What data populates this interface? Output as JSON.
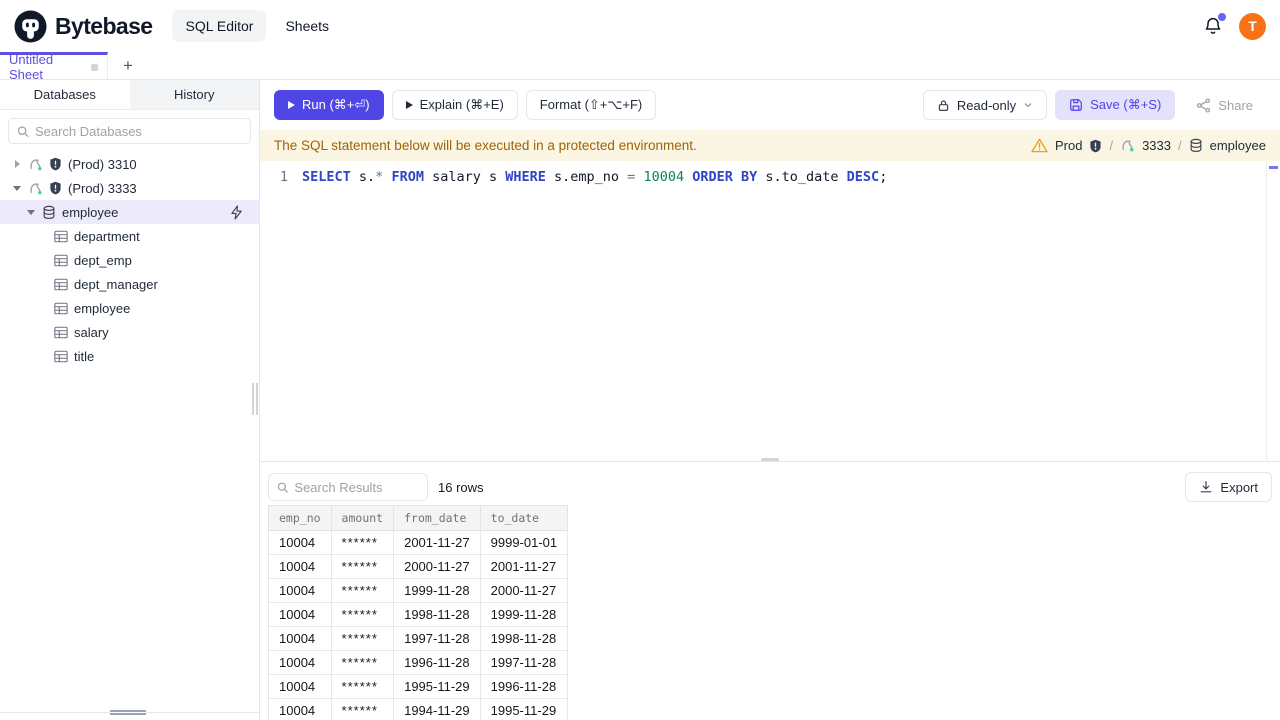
{
  "colors": {
    "accent": "#4f46e5",
    "accent_soft": "#e4e1fa",
    "selection_bg": "#eceafb",
    "tab_active": "#5b50e0",
    "banner_bg": "#faf6e3",
    "banner_text": "#a16207",
    "warning": "#f59e0b",
    "avatar_bg": "#f97316",
    "notification_dot": "#6366f1",
    "syntax_keyword": "#2f45c5",
    "syntax_number": "#098658",
    "syntax_operator": "#64748b"
  },
  "topbar": {
    "brand": "Bytebase",
    "nav": [
      {
        "label": "SQL Editor"
      },
      {
        "label": "Sheets"
      }
    ],
    "avatar_initial": "T"
  },
  "sheet_tabs": {
    "active_tab": "Untitled Sheet",
    "new_tab_label": "+"
  },
  "sidebar": {
    "tabs": [
      {
        "label": "Databases"
      },
      {
        "label": "History"
      }
    ],
    "search_placeholder": "Search Databases",
    "instances": [
      {
        "label": "(Prod) 3310"
      },
      {
        "label": "(Prod) 3333"
      }
    ],
    "database": {
      "label": "employee"
    },
    "tables": [
      {
        "label": "department"
      },
      {
        "label": "dept_emp"
      },
      {
        "label": "dept_manager"
      },
      {
        "label": "employee"
      },
      {
        "label": "salary"
      },
      {
        "label": "title"
      }
    ]
  },
  "toolbar": {
    "run_label": "Run (⌘+⏎)",
    "explain_label": "Explain (⌘+E)",
    "format_label": "Format (⇧+⌥+F)",
    "readonly_label": "Read-only",
    "save_label": "Save (⌘+S)",
    "share_label": "Share"
  },
  "banner": {
    "message": "The SQL statement below will be executed in a protected environment.",
    "environment": "Prod",
    "separator": "/",
    "instance": "3333",
    "database": "employee"
  },
  "editor": {
    "line_number": "1",
    "sql_text": "SELECT s.* FROM salary s WHERE s.emp_no = 10004 ORDER BY s.to_date DESC;",
    "tokens": [
      {
        "text": "SELECT",
        "type": "keyword"
      },
      {
        "text": " s.",
        "type": "ident"
      },
      {
        "text": "*",
        "type": "operator"
      },
      {
        "text": " ",
        "type": "ident"
      },
      {
        "text": "FROM",
        "type": "keyword"
      },
      {
        "text": " salary s ",
        "type": "ident"
      },
      {
        "text": "WHERE",
        "type": "keyword"
      },
      {
        "text": " s.emp_no ",
        "type": "ident"
      },
      {
        "text": "=",
        "type": "operator"
      },
      {
        "text": " ",
        "type": "ident"
      },
      {
        "text": "10004",
        "type": "number"
      },
      {
        "text": " ",
        "type": "ident"
      },
      {
        "text": "ORDER BY",
        "type": "keyword"
      },
      {
        "text": " s.to_date ",
        "type": "ident"
      },
      {
        "text": "DESC",
        "type": "keyword"
      },
      {
        "text": ";",
        "type": "ident"
      }
    ]
  },
  "results": {
    "search_placeholder": "Search Results",
    "row_count_label": "16 rows",
    "export_label": "Export",
    "columns": [
      "emp_no",
      "amount",
      "from_date",
      "to_date"
    ],
    "rows": [
      {
        "emp_no": "10004",
        "amount": "******",
        "from_date": "2001-11-27",
        "to_date": "9999-01-01"
      },
      {
        "emp_no": "10004",
        "amount": "******",
        "from_date": "2000-11-27",
        "to_date": "2001-11-27"
      },
      {
        "emp_no": "10004",
        "amount": "******",
        "from_date": "1999-11-28",
        "to_date": "2000-11-27"
      },
      {
        "emp_no": "10004",
        "amount": "******",
        "from_date": "1998-11-28",
        "to_date": "1999-11-28"
      },
      {
        "emp_no": "10004",
        "amount": "******",
        "from_date": "1997-11-28",
        "to_date": "1998-11-28"
      },
      {
        "emp_no": "10004",
        "amount": "******",
        "from_date": "1996-11-28",
        "to_date": "1997-11-28"
      },
      {
        "emp_no": "10004",
        "amount": "******",
        "from_date": "1995-11-29",
        "to_date": "1996-11-28"
      },
      {
        "emp_no": "10004",
        "amount": "******",
        "from_date": "1994-11-29",
        "to_date": "1995-11-29"
      }
    ]
  }
}
